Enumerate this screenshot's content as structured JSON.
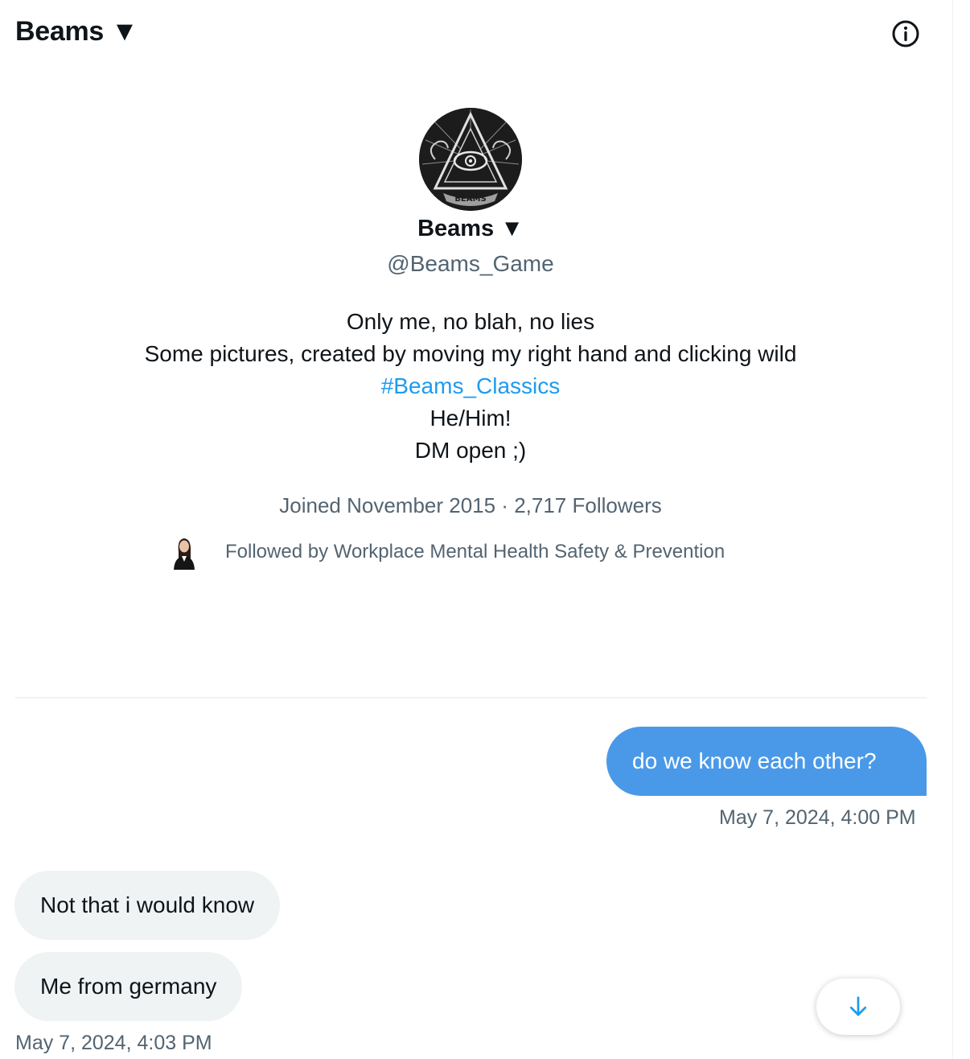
{
  "header": {
    "title": "Beams ▼"
  },
  "profile": {
    "name": "Beams ▼",
    "handle": "@Beams_Game",
    "avatar_text": "BEAMS",
    "bio": {
      "line1": "Only me, no blah, no lies",
      "line2": "Some pictures, created by moving my right hand and clicking wild",
      "hashtag": "#Beams_Classics",
      "line4": "He/Him!",
      "line5": "DM open ;)"
    },
    "meta": "Joined November 2015 · 2,717 Followers",
    "followed_by": "Followed by Workplace Mental Health Safety & Prevention"
  },
  "messages": [
    {
      "direction": "outgoing",
      "text": "do we know each other?"
    },
    {
      "direction": "outgoing-timestamp",
      "text": "May 7, 2024, 4:00 PM"
    },
    {
      "direction": "incoming",
      "text": "Not that i would know"
    },
    {
      "direction": "incoming",
      "text": "Me from germany"
    },
    {
      "direction": "incoming-timestamp",
      "text": "May 7, 2024, 4:03 PM"
    }
  ],
  "colors": {
    "accent": "#1d9bf0",
    "outgoing_bubble": "#4a99e9",
    "incoming_bubble": "#eff3f4",
    "secondary_text": "#536471"
  },
  "icons": {
    "info": "info-circle-icon",
    "scroll": "arrow-down-icon"
  }
}
